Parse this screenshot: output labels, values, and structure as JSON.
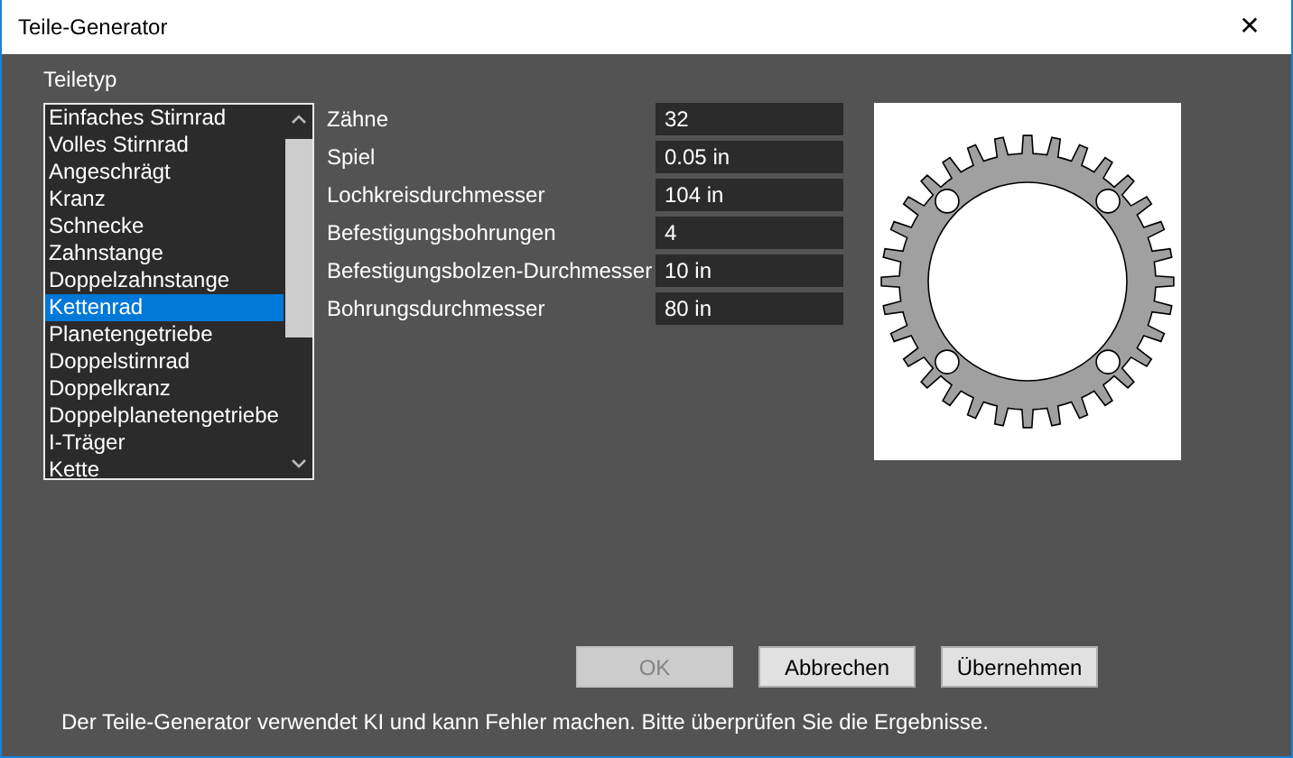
{
  "window": {
    "title": "Teile-Generator",
    "close": "✕"
  },
  "part_type": {
    "label": "Teiletyp",
    "items": [
      {
        "label": "Einfaches Stirnrad",
        "selected": false
      },
      {
        "label": "Volles Stirnrad",
        "selected": false
      },
      {
        "label": "Angeschrägt",
        "selected": false
      },
      {
        "label": "Kranz",
        "selected": false
      },
      {
        "label": "Schnecke",
        "selected": false
      },
      {
        "label": "Zahnstange",
        "selected": false
      },
      {
        "label": "Doppelzahnstange",
        "selected": false
      },
      {
        "label": "Kettenrad",
        "selected": true
      },
      {
        "label": "Planetengetriebe",
        "selected": false
      },
      {
        "label": "Doppelstirnrad",
        "selected": false
      },
      {
        "label": "Doppelkranz",
        "selected": false
      },
      {
        "label": "Doppelplanetengetriebe",
        "selected": false
      },
      {
        "label": "I-Träger",
        "selected": false
      },
      {
        "label": "Kette",
        "selected": false
      }
    ]
  },
  "parameters": [
    {
      "label": "Zähne",
      "value": "32"
    },
    {
      "label": "Spiel",
      "value": "0.05 in"
    },
    {
      "label": "Lochkreisdurchmesser",
      "value": "104 in"
    },
    {
      "label": "Befestigungsbohrungen",
      "value": "4"
    },
    {
      "label": "Befestigungsbolzen-Durchmesser",
      "value": "10 in"
    },
    {
      "label": "Bohrungsdurchmesser",
      "value": "80 in"
    }
  ],
  "buttons": [
    {
      "label": "OK",
      "disabled": true
    },
    {
      "label": "Abbrechen",
      "disabled": false
    },
    {
      "label": "Übernehmen",
      "disabled": false
    }
  ],
  "footer": "Der Teile-Generator verwendet KI und kann Fehler machen. Bitte überprüfen Sie die Ergebnisse."
}
